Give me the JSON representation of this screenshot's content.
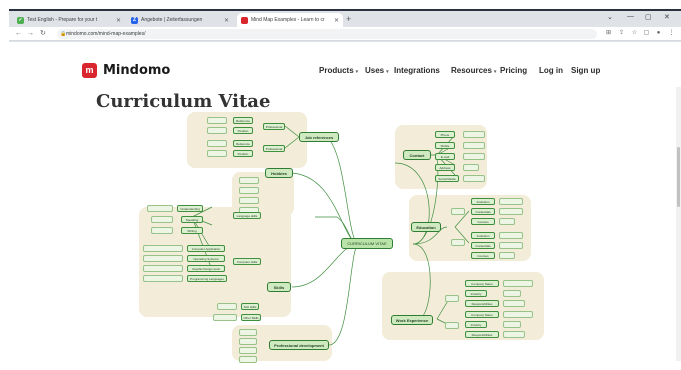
{
  "browser": {
    "tabs": [
      {
        "label": "Test English - Prepare for your t",
        "fav_color": "#4caf50",
        "fav_text": "",
        "active": false
      },
      {
        "label": "Angebote | Zeiterfassungen",
        "fav_color": "#2563eb",
        "fav_text": "Z",
        "active": false
      },
      {
        "label": "Mind Map Examples - Learn to cr",
        "fav_color": "#d9262e",
        "fav_text": "",
        "active": true
      }
    ],
    "new_tab": "+",
    "window_controls": [
      "⌄",
      "—",
      "▢",
      "✕"
    ],
    "url": "mindomo.com/mind-map-examples/"
  },
  "site": {
    "logo_mark": "m",
    "logo_text": "Mindomo",
    "nav": {
      "products": "Products",
      "uses": "Uses",
      "integrations": "Integrations",
      "resources": "Resources",
      "pricing": "Pricing",
      "login": "Log in",
      "signup": "Sign up"
    }
  },
  "content": {
    "title": "Curriculum Vitae"
  },
  "mindmap": {
    "center": "CURRICULUM VITAE",
    "job_references": "Job references",
    "job_ref_sub": [
      "Professional",
      "Professional"
    ],
    "job_ref_leaves": [
      "Reference",
      "Position",
      "Reference",
      "Position"
    ],
    "contact": "Contact",
    "contact_items": [
      "Phone",
      "Mobile",
      "E-mail",
      "Address",
      "Social Media"
    ],
    "hobbies": "Hobbies",
    "education": "Education",
    "education_items": [
      "Institution",
      "Credentials",
      "Courses",
      "Institution",
      "Credentials",
      "Courses"
    ],
    "skills": "Skills",
    "skills_items": [
      "Language skills",
      "Computer skills",
      "Soft skills",
      "Other Skills"
    ],
    "skills_leaves": [
      "Understanding",
      "Speaking",
      "Writing",
      "Computer Application",
      "Operating Systems",
      "Graphic Design tools",
      "Programming Languages"
    ],
    "work_experience": "Work Experience",
    "work_items": [
      "Company Name",
      "Industry",
      "Responsibilities",
      "Company Name",
      "Industry",
      "Responsibilities"
    ],
    "professional_development": "Professional development"
  },
  "colors": {
    "brand": "#d9262e",
    "node_fill": "#def0d2",
    "node_border": "#3f8f3f",
    "group_fill": "#f2ecd9"
  }
}
